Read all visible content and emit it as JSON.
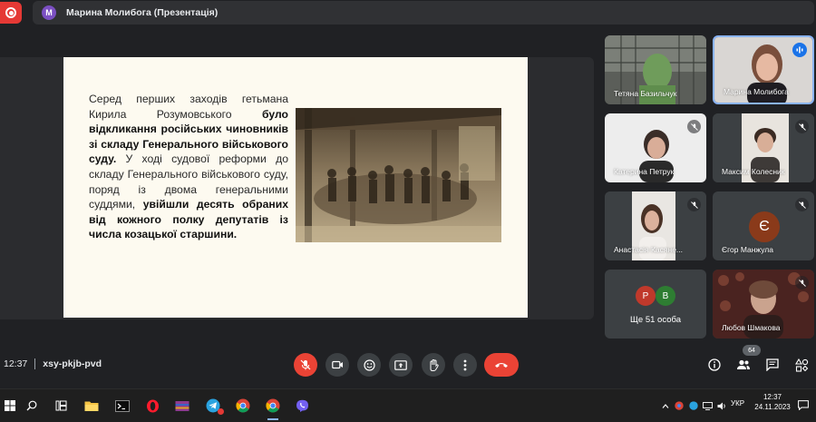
{
  "header": {
    "presenter_initial": "M",
    "presenter_title": "Марина Молибога (Презентація)"
  },
  "slide": {
    "line1": "Серед перших заходів гетьмана Кирила Розумовського ",
    "bold1": "було відкликання російських чиновників зі складу Генерального військового суду.",
    "line2": " У ході судової реформи до складу Генерального військового суду, поряд із двома генеральними суддями, ",
    "bold2": "увійшли десять обраних від кожного полку депутатів із числа козацької старшини."
  },
  "participants": [
    {
      "name": "Тетяна Базильчук"
    },
    {
      "name": "Марина Молибога"
    },
    {
      "name": "Катерина Петрук"
    },
    {
      "name": "Максим Колесник"
    },
    {
      "name": "Анастасія Касяне..."
    },
    {
      "name": "Єгор Манжула",
      "initial": "Є"
    },
    {
      "name": "Ще 51 особа",
      "initials": [
        "Р",
        "В"
      ]
    },
    {
      "name": "Любов Шмакова"
    }
  ],
  "people_count": "64",
  "meeting": {
    "time": "12:37",
    "code": "xsy-pkjb-pvd"
  },
  "taskbar": {
    "lang": "УКР",
    "time": "12:37",
    "date": "24.11.2023"
  },
  "colors": {
    "background": "#202124",
    "danger": "#ea4335",
    "accent": "#8ab4f8",
    "slide_bg": "#fdfaf0"
  }
}
